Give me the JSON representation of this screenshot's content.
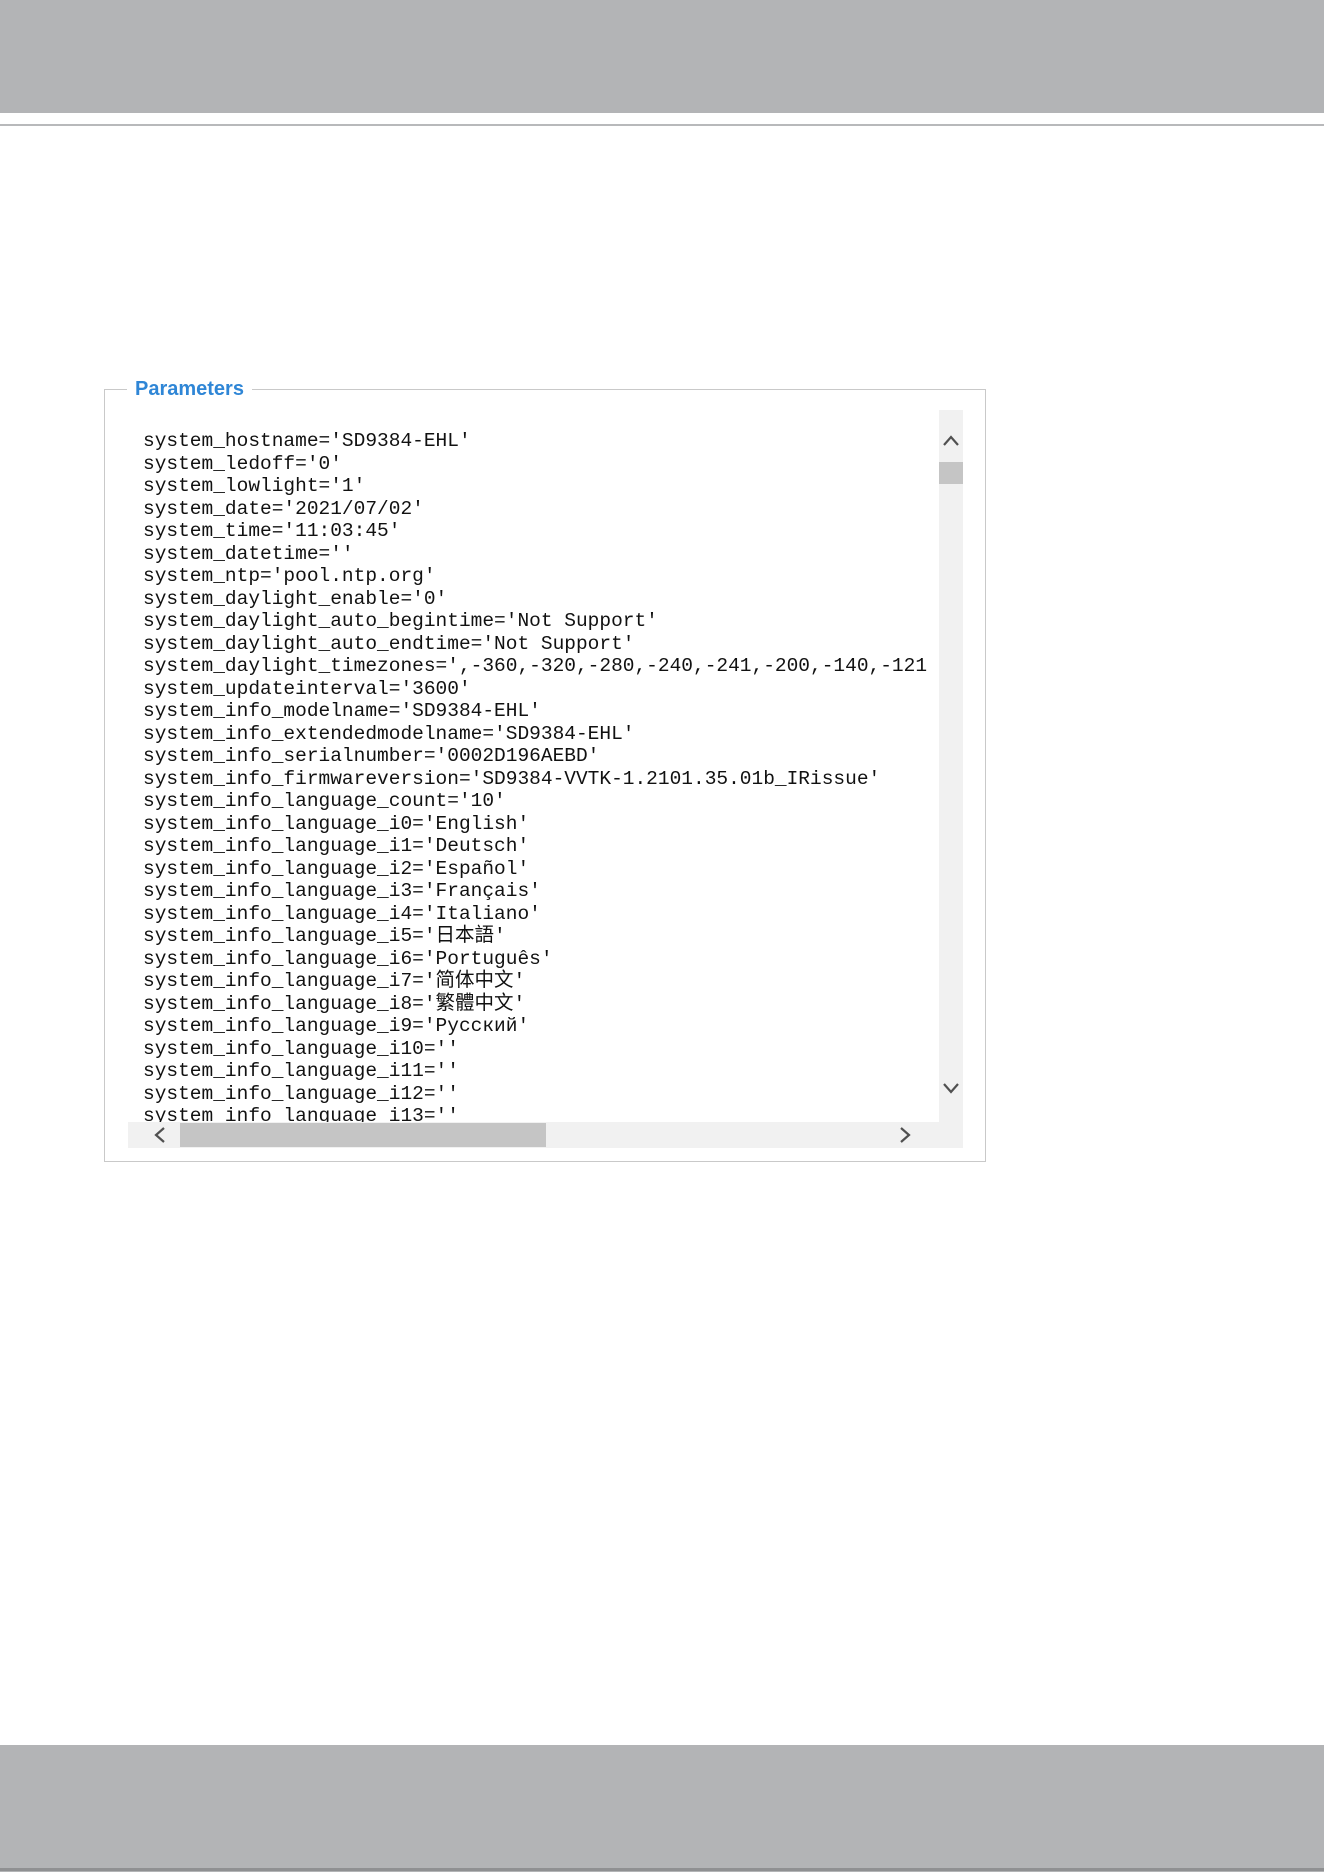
{
  "fieldset": {
    "legend": "Parameters"
  },
  "parameters": [
    "system_hostname='SD9384-EHL'",
    "system_ledoff='0'",
    "system_lowlight='1'",
    "system_date='2021/07/02'",
    "system_time='11:03:45'",
    "system_datetime=''",
    "system_ntp='pool.ntp.org'",
    "system_daylight_enable='0'",
    "system_daylight_auto_begintime='Not Support'",
    "system_daylight_auto_endtime='Not Support'",
    "system_daylight_timezones=',-360,-320,-280,-240,-241,-200,-140,-121",
    "system_updateinterval='3600'",
    "system_info_modelname='SD9384-EHL'",
    "system_info_extendedmodelname='SD9384-EHL'",
    "system_info_serialnumber='0002D196AEBD'",
    "system_info_firmwareversion='SD9384-VVTK-1.2101.35.01b_IRissue'",
    "system_info_language_count='10'",
    "system_info_language_i0='English'",
    "system_info_language_i1='Deutsch'",
    "system_info_language_i2='Español'",
    "system_info_language_i3='Français'",
    "system_info_language_i4='Italiano'",
    "system_info_language_i5='日本語'",
    "system_info_language_i6='Português'",
    "system_info_language_i7='简体中文'",
    "system_info_language_i8='繁體中文'",
    "system_info_language_i9='Русский'",
    "system_info_language_i10=''",
    "system_info_language_i11=''",
    "system_info_language_i12=''",
    "system_info_language_i13=''"
  ],
  "scrollbars": {
    "vertical_position": 0.0,
    "horizontal_position": 0.0
  },
  "icons": {
    "up": "chevron-up-icon",
    "down": "chevron-down-icon",
    "left": "chevron-left-icon",
    "right": "chevron-right-icon"
  },
  "colors": {
    "band": "#b3b4b6",
    "legend": "#2f86d6",
    "scrollbar_track": "#f1f1f1",
    "scrollbar_thumb": "#c5c5c5"
  }
}
